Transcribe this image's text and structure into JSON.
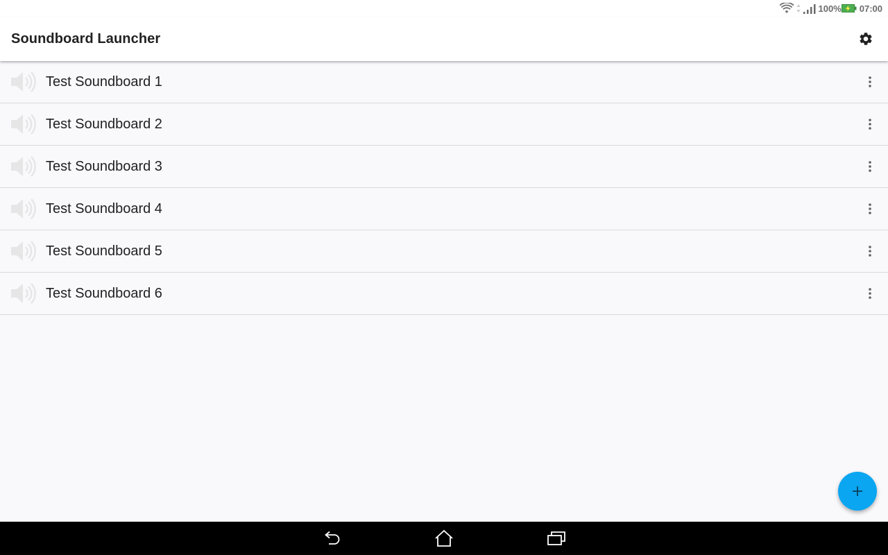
{
  "status_bar": {
    "battery_text": "100%",
    "time": "07:00",
    "icons": [
      "wifi-icon",
      "data-arrows-icon",
      "signal-icon",
      "battery-charging-icon"
    ],
    "battery_color": "#4caf50"
  },
  "app_bar": {
    "title": "Soundboard Launcher",
    "settings_icon": "gear-icon"
  },
  "soundboards": [
    {
      "label": "Test Soundboard 1",
      "icon": "speaker-icon"
    },
    {
      "label": "Test Soundboard 2",
      "icon": "speaker-icon"
    },
    {
      "label": "Test Soundboard 3",
      "icon": "speaker-icon"
    },
    {
      "label": "Test Soundboard 4",
      "icon": "speaker-icon"
    },
    {
      "label": "Test Soundboard 5",
      "icon": "speaker-icon"
    },
    {
      "label": "Test Soundboard 6",
      "icon": "speaker-icon"
    }
  ],
  "fab": {
    "icon": "plus-icon",
    "color": "#0aa6f1"
  },
  "nav_bar": {
    "buttons": [
      "back-icon",
      "home-icon",
      "recents-icon"
    ]
  }
}
